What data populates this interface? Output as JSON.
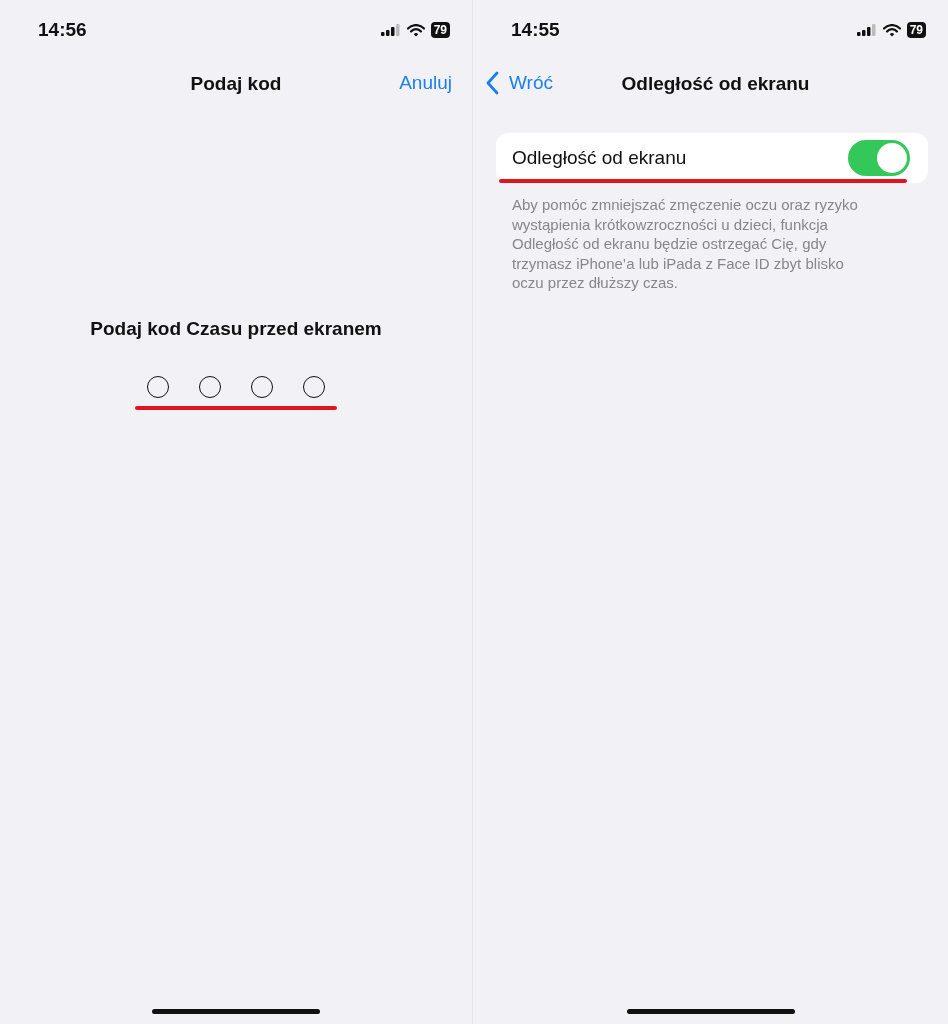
{
  "screens": [
    {
      "kind": "passcode",
      "status_bar": {
        "time": "14:56",
        "battery": "79"
      },
      "nav": {
        "title": "Podaj kod",
        "cancel": "Anuluj"
      },
      "prompt": "Podaj kod Czasu przed ekranem",
      "passcode": [
        {
          "filled": false
        },
        {
          "filled": false
        },
        {
          "filled": false
        },
        {
          "filled": false
        }
      ]
    },
    {
      "kind": "settings",
      "status_bar": {
        "time": "14:55",
        "battery": "79"
      },
      "nav": {
        "back": "Wróć",
        "title": "Odległość od ekranu"
      },
      "setting": {
        "label": "Odległość od ekranu",
        "on": true
      },
      "footer": "Aby pomóc zmniejszać zmęczenie oczu oraz ryzyko wystąpienia krótkowzroczności u dzieci, funkcja Odległość od ekranu będzie ostrzegać Cię, gdy trzymasz iPhone’a lub iPada z Face ID zbyt blisko oczu przez dłuższy czas."
    }
  ]
}
